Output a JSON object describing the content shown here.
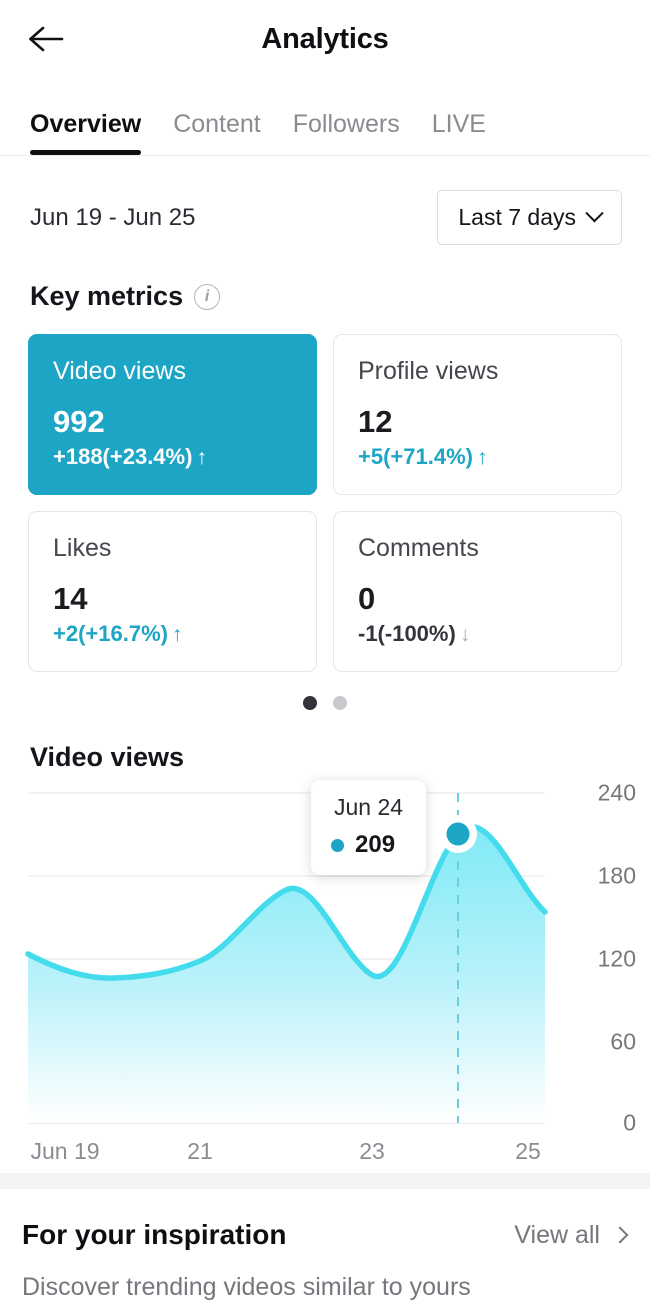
{
  "header": {
    "title": "Analytics",
    "back_icon": "arrow-left-icon"
  },
  "tabs": [
    {
      "label": "Overview",
      "active": true
    },
    {
      "label": "Content",
      "active": false
    },
    {
      "label": "Followers",
      "active": false
    },
    {
      "label": "LIVE",
      "active": false
    }
  ],
  "date_row": {
    "range_text": "Jun 19 - Jun 25",
    "picker_label": "Last 7 days",
    "picker_icon": "chevron-down-icon"
  },
  "key_metrics": {
    "title": "Key metrics",
    "info_icon": "info-icon",
    "cards": [
      {
        "label": "Video views",
        "value": "992",
        "delta": "+188(+23.4%)",
        "trend": "up",
        "arrow": "↑",
        "selected": true,
        "accent": "#1CA5C4"
      },
      {
        "label": "Profile views",
        "value": "12",
        "delta": "+5(+71.4%)",
        "trend": "up",
        "arrow": "↑",
        "selected": false,
        "accent": "#1CA5C4"
      },
      {
        "label": "Likes",
        "value": "14",
        "delta": "+2(+16.7%)",
        "trend": "up",
        "arrow": "↑",
        "selected": false,
        "accent": "#1CA5C4"
      },
      {
        "label": "Comments",
        "value": "0",
        "delta": "-1(-100%)",
        "trend": "down",
        "arrow": "↓",
        "selected": false,
        "accent": "#33343b"
      }
    ],
    "pagination": {
      "total": 2,
      "current": 1
    }
  },
  "chart_data": {
    "type": "area",
    "title": "Video views",
    "xlabel": "",
    "ylabel": "",
    "x": [
      "Jun 19",
      "Jun 20",
      "Jun 21",
      "Jun 22",
      "Jun 23",
      "Jun 24",
      "Jun 25"
    ],
    "tick_labels_x": [
      "Jun 19",
      "21",
      "23",
      "25"
    ],
    "tick_labels_y": [
      "240",
      "180",
      "120",
      "60",
      "0"
    ],
    "values": [
      122,
      105,
      112,
      165,
      107,
      209,
      152
    ],
    "ylim": [
      0,
      240
    ],
    "yticks": [
      0,
      60,
      120,
      180,
      240
    ],
    "grid": true,
    "legend": "none",
    "line_color": "#44DCEC",
    "fill_top_color": "#7FEAF6",
    "fill_bottom_color": "#FFFFFF",
    "highlight": {
      "date": "Jun 24",
      "value": "209",
      "marker_color": "#1CA5C4",
      "guide": "dashed"
    }
  },
  "inspiration": {
    "title": "For your inspiration",
    "view_all": "View all",
    "view_all_icon": "chevron-right-icon",
    "subtitle": "Discover trending videos similar to yours"
  }
}
